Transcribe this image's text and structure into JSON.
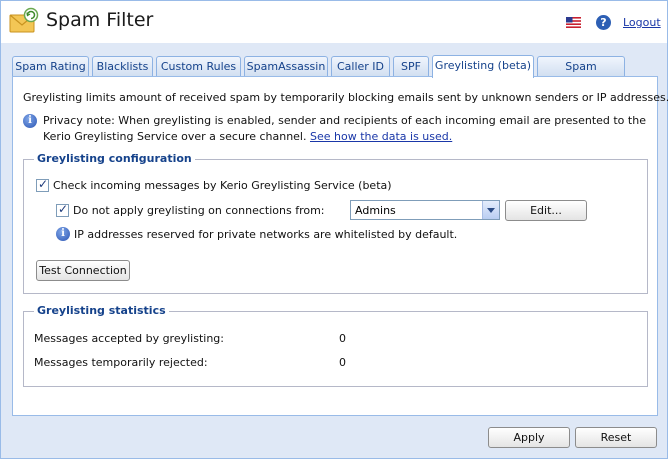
{
  "app": {
    "title": "Spam Filter",
    "logout_label": "Logout",
    "help_glyph": "?"
  },
  "icons": {
    "app": "envelope-filter-icon",
    "flag": "us-flag-icon",
    "help": "help-icon",
    "info": "info-icon"
  },
  "colors": {
    "accent": "#15428b",
    "link": "#1a37a8",
    "panel_border": "#99bbe8",
    "window_bg": "#dfe8f6"
  },
  "tabs": [
    {
      "label": "Spam Rating",
      "active": false
    },
    {
      "label": "Blacklists",
      "active": false
    },
    {
      "label": "Custom Rules",
      "active": false
    },
    {
      "label": "SpamAssassin",
      "active": false
    },
    {
      "label": "Caller ID",
      "active": false
    },
    {
      "label": "SPF",
      "active": false
    },
    {
      "label": "Greylisting (beta)",
      "active": true
    },
    {
      "label": "Spam Repellent",
      "active": false
    }
  ],
  "description": "Greylisting limits amount of received spam by temporarily blocking emails sent by unknown senders or IP addresses.",
  "privacy": {
    "text": "Privacy note: When greylisting is enabled, sender and recipients of each incoming email are presented to the Kerio Greylisting Service over a secure channel.",
    "link_label": "See how the data is used."
  },
  "config": {
    "legend": "Greylisting configuration",
    "check_service_label": "Check incoming messages by Kerio Greylisting Service (beta)",
    "check_service_checked": true,
    "exclude_label": "Do not apply greylisting on connections from:",
    "exclude_checked": true,
    "exclude_select_value": "Admins",
    "edit_label": "Edit...",
    "private_networks_note": "IP addresses reserved for private networks are whitelisted by default.",
    "test_connection_label": "Test Connection"
  },
  "stats": {
    "legend": "Greylisting statistics",
    "rows": [
      {
        "label": "Messages accepted by greylisting:",
        "value": "0"
      },
      {
        "label": "Messages temporarily rejected:",
        "value": "0"
      }
    ]
  },
  "footer": {
    "apply_label": "Apply",
    "reset_label": "Reset"
  }
}
